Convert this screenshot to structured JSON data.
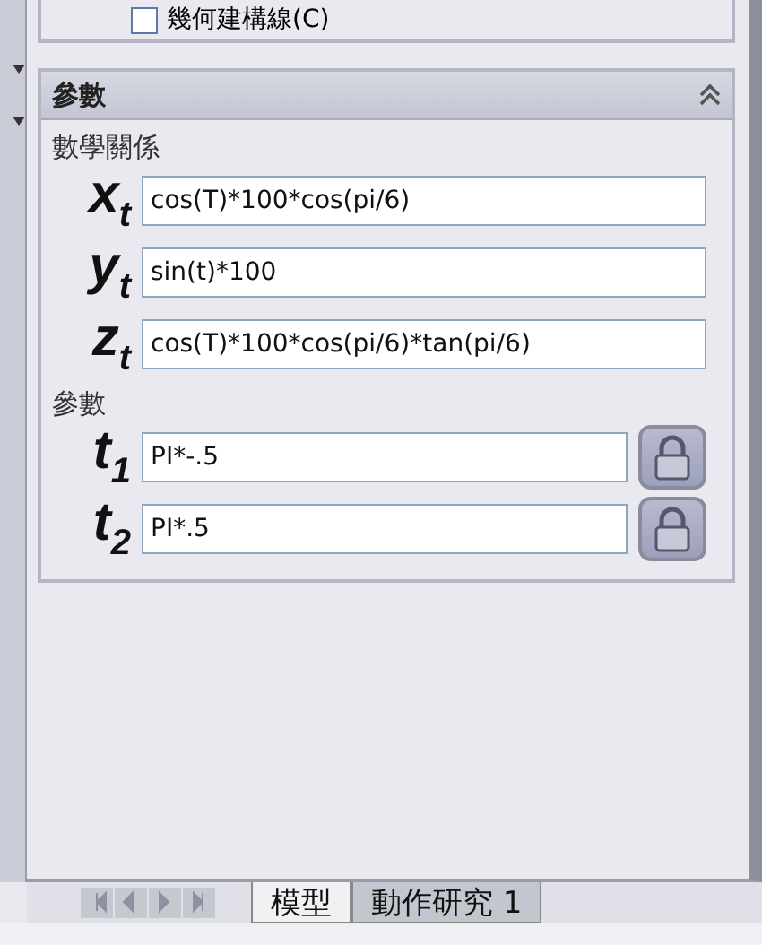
{
  "top_option": {
    "label": "幾何建構線(C)",
    "checked": false
  },
  "panel": {
    "title": "參數",
    "expanded": true,
    "section_label": "數學關係",
    "equations": [
      {
        "symbol": "x$_{t}$",
        "value": "cos(T)*100*cos(pi/6)"
      },
      {
        "symbol": "y$_{t}$",
        "value": "sin(t)*100"
      },
      {
        "symbol": "z$_{t}$",
        "value": "cos(T)*100*cos(pi/6)*tan(pi/6)"
      }
    ],
    "params_label": "參數",
    "parameters": [
      {
        "symbol": "t$_{1}$",
        "value": "PI*-.5"
      },
      {
        "symbol": "t$_{2}$",
        "value": "PI*.5"
      }
    ]
  },
  "tabs": [
    {
      "label": "模型",
      "selected": true
    },
    {
      "label": "動作研究 1",
      "selected": false
    }
  ]
}
